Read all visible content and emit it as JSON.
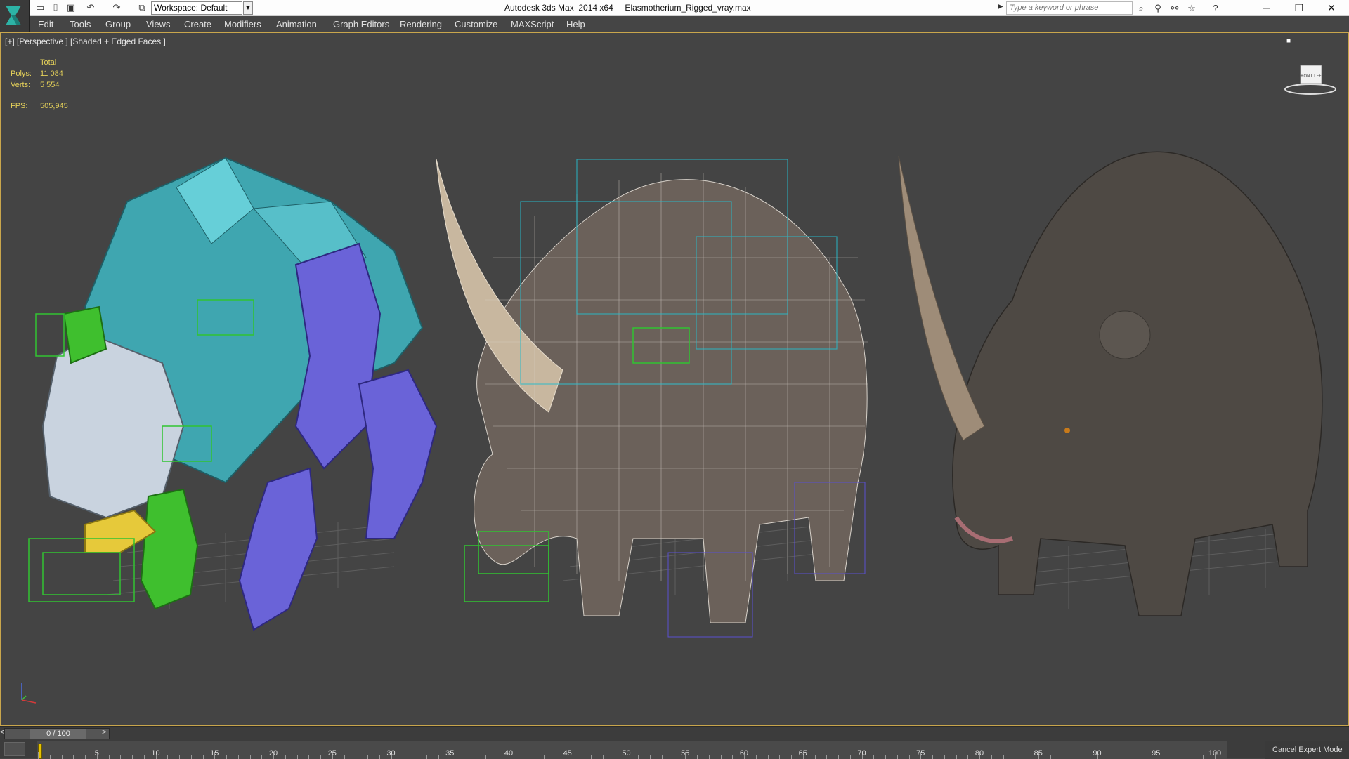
{
  "titlebar": {
    "workspace_label": "Workspace: Default",
    "app_title": "Autodesk 3ds Max  2014 x64     Elasmotherium_Rigged_vray.max",
    "search_placeholder": "Type a keyword or phrase",
    "quick_access_icons": [
      "new-file-icon",
      "open-file-icon",
      "save-icon",
      "undo-icon",
      "redo-icon",
      "project-icon"
    ],
    "tool_icons": [
      "binoculars-icon",
      "search-tool-icon",
      "connect-icon",
      "star-icon",
      "help-icon"
    ],
    "window_buttons": [
      "minimize",
      "restore",
      "close"
    ]
  },
  "menu": {
    "items": [
      {
        "label": "Edit"
      },
      {
        "label": "Tools"
      },
      {
        "label": "Group"
      },
      {
        "label": "Views"
      },
      {
        "label": "Create"
      },
      {
        "label": "Modifiers"
      },
      {
        "label": "Animation"
      },
      {
        "label": "Graph Editors"
      },
      {
        "label": "Rendering"
      },
      {
        "label": "Customize"
      },
      {
        "label": "MAXScript"
      },
      {
        "label": "Help"
      }
    ]
  },
  "viewport": {
    "label": "[+] [Perspective ] [Shaded + Edged Faces ]",
    "stats": {
      "total_label": "Total",
      "polys_label": "Polys:",
      "polys_value": "11 084",
      "verts_label": "Verts:",
      "verts_value": "5 554",
      "fps_label": "FPS:",
      "fps_value": "505,945"
    },
    "viewcube_label": "FRONT  LEFT"
  },
  "timeline": {
    "slider_text": "0 / 100",
    "prev_label": "<",
    "next_label": ">",
    "ticks": [
      "0",
      "5",
      "10",
      "15",
      "20",
      "25",
      "30",
      "35",
      "40",
      "45",
      "50",
      "55",
      "60",
      "65",
      "70",
      "75",
      "80",
      "85",
      "90",
      "95",
      "100"
    ],
    "cancel_expert_label": "Cancel Expert Mode"
  }
}
